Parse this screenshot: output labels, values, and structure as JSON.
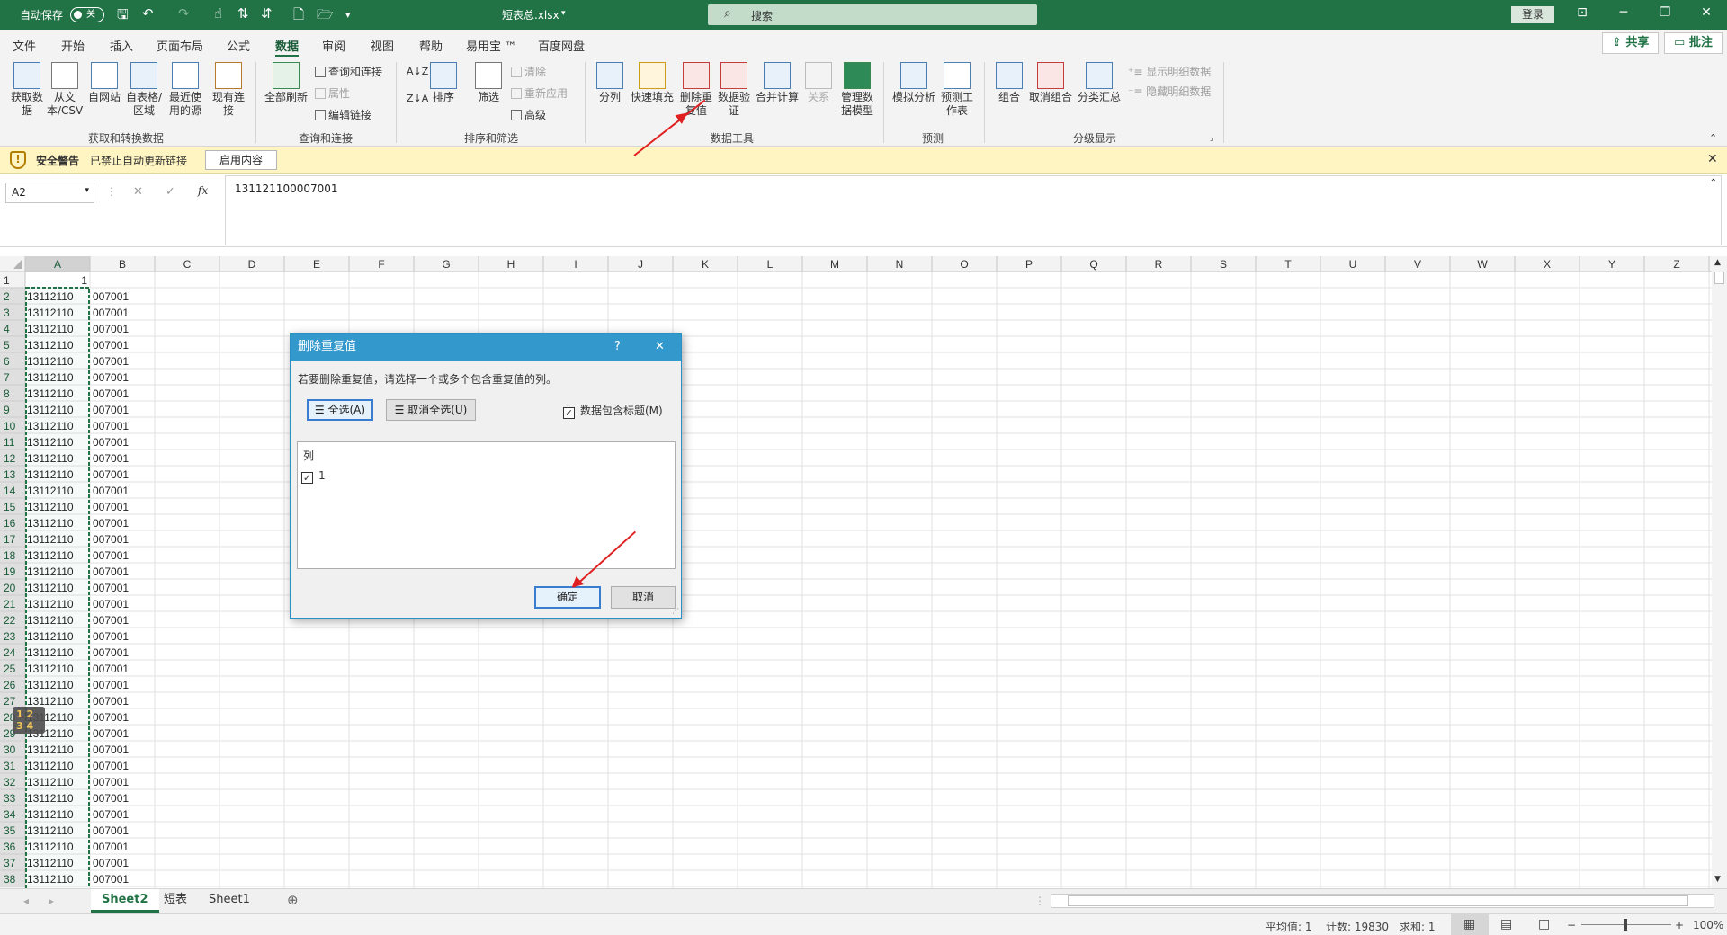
{
  "title": {
    "autosave": "自动保存",
    "autosave_state": "关",
    "filename": "短表总.xlsx",
    "search_placeholder": "搜索",
    "login": "登录"
  },
  "menu": [
    "文件",
    "开始",
    "插入",
    "页面布局",
    "公式",
    "数据",
    "审阅",
    "视图",
    "帮助",
    "易用宝 ™",
    "百度网盘"
  ],
  "menu_active": "数据",
  "share": "共享",
  "comment": "批注",
  "ribbon": {
    "get_data": "获取数据",
    "from_text": "从文本/CSV",
    "from_web": "自网站",
    "from_table": "自表格/区域",
    "recent": "最近使用的源",
    "existing": "现有连接",
    "group1": "获取和转换数据",
    "refresh_all": "全部刷新",
    "queries": "查询和连接",
    "properties": "属性",
    "edit_links": "编辑链接",
    "group2": "查询和连接",
    "sort_az": "A↓Z",
    "sort_za": "Z↓A",
    "sort": "排序",
    "filter": "筛选",
    "clear": "清除",
    "reapply": "重新应用",
    "advanced": "高级",
    "group3": "排序和筛选",
    "split": "分列",
    "flash_fill": "快速填充",
    "remove_dup": "删除重复值",
    "validation": "数据验证",
    "consolidate": "合并计算",
    "relations": "关系",
    "data_model": "管理数据模型",
    "group4": "数据工具",
    "what_if": "模拟分析",
    "forecast": "预测工作表",
    "group5": "预测",
    "group_btn": "组合",
    "ungroup": "取消组合",
    "subtotal": "分类汇总",
    "show_detail": "显示明细数据",
    "hide_detail": "隐藏明细数据",
    "group6": "分级显示"
  },
  "security": {
    "title": "安全警告",
    "message": "已禁止自动更新链接",
    "enable": "启用内容"
  },
  "formula_bar": {
    "name_box": "A2",
    "cancel": "✕",
    "enter": "✓",
    "fx": "fx",
    "value": "131121100007001"
  },
  "columns": [
    "A",
    "B",
    "C",
    "D",
    "E",
    "F",
    "G",
    "H",
    "I",
    "J",
    "K",
    "L",
    "M",
    "N",
    "O",
    "P",
    "Q",
    "R",
    "S",
    "T",
    "U",
    "V",
    "W",
    "X",
    "Y",
    "Z"
  ],
  "rows": [
    "1",
    "2",
    "3",
    "4",
    "5",
    "6",
    "7",
    "8",
    "9",
    "10",
    "11",
    "12",
    "13",
    "14",
    "15",
    "16",
    "17",
    "18",
    "19",
    "20",
    "21",
    "22",
    "23",
    "24",
    "25",
    "26",
    "27",
    "28",
    "29",
    "30",
    "31",
    "32",
    "33",
    "34",
    "35",
    "36",
    "37",
    "38"
  ],
  "cell_a1": "1",
  "cell_a_prefix": "13112110",
  "cell_b_text": "007001",
  "outline_levels": [
    "1",
    "2",
    "3",
    "4"
  ],
  "dialog": {
    "title": "删除重复值",
    "help": "?",
    "close": "✕",
    "instruction": "若要删除重复值，请选择一个或多个包含重复值的列。",
    "select_all": "全选(A)",
    "unselect_all": "取消全选(U)",
    "header_check": "数据包含标题(M)",
    "list_header": "列",
    "list_items": [
      "1"
    ],
    "ok": "确定",
    "cancel": "取消"
  },
  "sheets": [
    "Sheet2",
    "短表",
    "Sheet1"
  ],
  "active_sheet": "Sheet2",
  "status": {
    "average": "平均值: 1",
    "count": "计数: 19830",
    "sum": "求和: 1",
    "zoom": "100%"
  },
  "colors": {
    "excel_green": "#217346",
    "dialog_blue": "#3399cc",
    "annotation_red": "#e02020"
  }
}
